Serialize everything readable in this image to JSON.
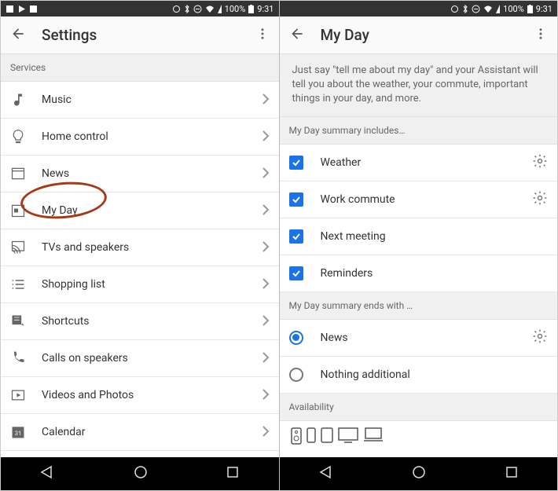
{
  "status": {
    "battery": "100%",
    "time": "9:31"
  },
  "left": {
    "title": "Settings",
    "services_header": "Services",
    "items": [
      {
        "label": "Music"
      },
      {
        "label": "Home control"
      },
      {
        "label": "News"
      },
      {
        "label": "My Day"
      },
      {
        "label": "TVs and speakers"
      },
      {
        "label": "Shopping list"
      },
      {
        "label": "Shortcuts"
      },
      {
        "label": "Calls on speakers"
      },
      {
        "label": "Videos and Photos"
      },
      {
        "label": "Calendar"
      }
    ]
  },
  "right": {
    "title": "My Day",
    "intro": "Just say \"tell me about my day\" and your Assistant will tell you about the weather, your commute, important things in your day, and more.",
    "includes_header": "My Day summary includes…",
    "checks": [
      {
        "label": "Weather",
        "gear": true
      },
      {
        "label": "Work commute",
        "gear": true
      },
      {
        "label": "Next meeting",
        "gear": false
      },
      {
        "label": "Reminders",
        "gear": false
      }
    ],
    "ends_header": "My Day summary ends with …",
    "radios": [
      {
        "label": "News",
        "selected": true,
        "gear": true
      },
      {
        "label": "Nothing additional",
        "selected": false,
        "gear": false
      }
    ],
    "availability_header": "Availability"
  }
}
